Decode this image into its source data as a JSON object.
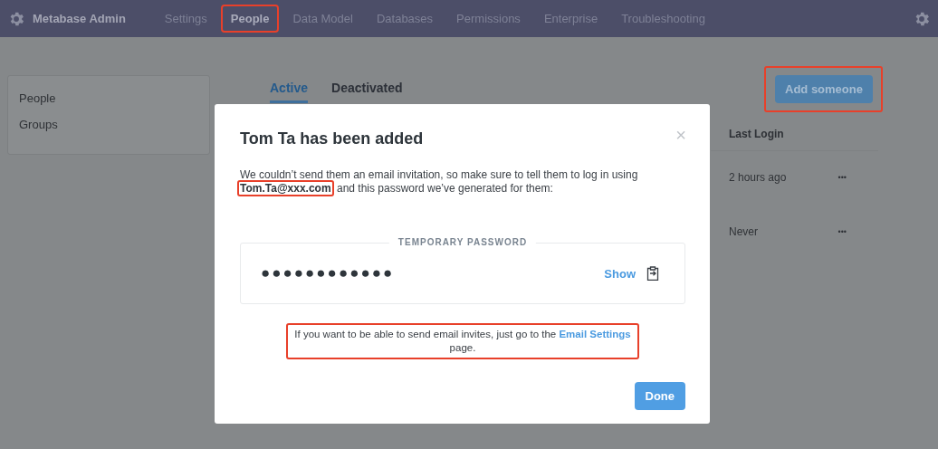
{
  "header": {
    "brand": "Metabase Admin",
    "nav": [
      {
        "label": "Settings",
        "selected": false,
        "highlighted": false
      },
      {
        "label": "People",
        "selected": true,
        "highlighted": true
      },
      {
        "label": "Data Model",
        "selected": false,
        "highlighted": false
      },
      {
        "label": "Databases",
        "selected": false,
        "highlighted": false
      },
      {
        "label": "Permissions",
        "selected": false,
        "highlighted": false
      },
      {
        "label": "Enterprise",
        "selected": false,
        "highlighted": false
      },
      {
        "label": "Troubleshooting",
        "selected": false,
        "highlighted": false
      }
    ]
  },
  "sidebar": {
    "items": [
      {
        "label": "People"
      },
      {
        "label": "Groups"
      }
    ]
  },
  "tabs": [
    {
      "label": "Active",
      "selected": true
    },
    {
      "label": "Deactivated",
      "selected": false
    }
  ],
  "add_button": {
    "label": "Add someone",
    "highlighted": true
  },
  "table": {
    "column_last_login": "Last Login",
    "rows": [
      {
        "last_login": "2 hours ago",
        "menu": "•••"
      },
      {
        "last_login": "Never",
        "menu": "•••"
      }
    ]
  },
  "modal": {
    "title": "Tom Ta has been added",
    "close": "×",
    "message_before": "We couldn’t send them an email invitation, so make sure to tell them to log in using",
    "email": "Tom.Ta@xxx.com",
    "email_highlighted": true,
    "message_after": "and this password we’ve generated for them:",
    "password_legend": "TEMPORARY PASSWORD",
    "password_mask": "●●●●●●●●●●●●",
    "show_label": "Show",
    "note_text": "If you want to be able to send email invites, just go to the",
    "note_link": "Email Settings",
    "note_end": "page.",
    "note_highlighted": true,
    "done": "Done"
  }
}
